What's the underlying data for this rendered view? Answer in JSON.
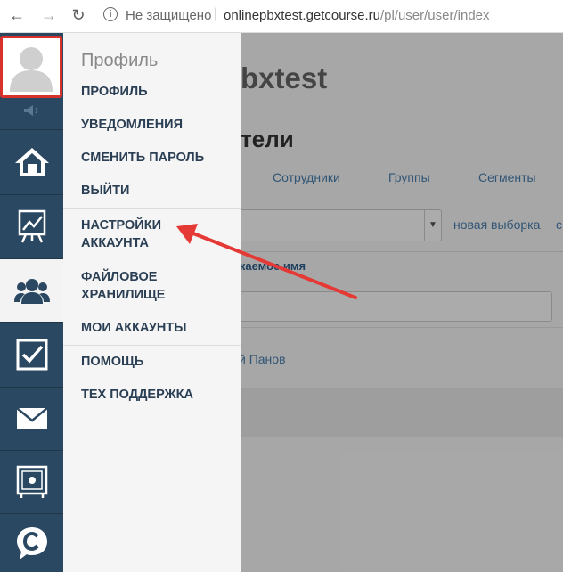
{
  "browser": {
    "not_secure": "Не защищено",
    "url_host": "onlinepbxtest.getcourse.ru",
    "url_path": "/pl/user/user/index"
  },
  "page": {
    "brand": "bxtest",
    "heading": "тели",
    "tabs": [
      "Сотрудники",
      "Группы",
      "Сегменты"
    ],
    "new_selection": "новая выборка",
    "new_selection_cut": "с",
    "column_label": "жаемое имя",
    "user_name": "й Панов"
  },
  "menu": {
    "title": "Профиль",
    "items": [
      "ПРОФИЛЬ",
      "УВЕДОМЛЕНИЯ",
      "СМЕНИТЬ ПАРОЛЬ",
      "ВЫЙТИ",
      "НАСТРОЙКИ\nАККАУНТА",
      "ФАЙЛОВОЕ\nХРАНИЛИЩЕ",
      "МОИ АККАУНТЫ",
      "ПОМОЩЬ",
      "ТЕХ ПОДДЕРЖКА"
    ]
  },
  "sidebar": {
    "icons": [
      "avatar-icon",
      "speaker-icon",
      "home-icon",
      "chart-icon",
      "users-icon",
      "checkbox-icon",
      "mail-icon",
      "safe-icon",
      "getcourse-logo-icon"
    ],
    "accent": "#2b4862"
  },
  "annotation": {
    "color": "#e53935",
    "highlight": "#d6312b"
  }
}
